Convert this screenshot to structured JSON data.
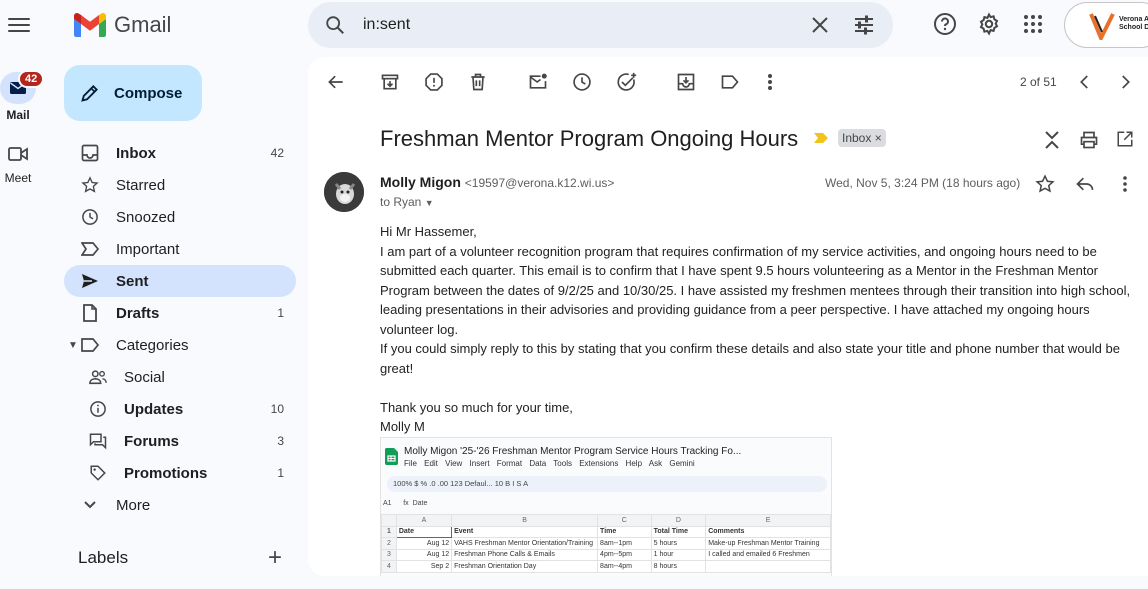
{
  "app": {
    "name": "Gmail"
  },
  "search": {
    "value": "in:sent"
  },
  "school": {
    "name": "Verona Area School District"
  },
  "rail": {
    "mail_label": "Mail",
    "mail_badge": "42",
    "meet_label": "Meet"
  },
  "compose": {
    "label": "Compose"
  },
  "nav": {
    "inbox": {
      "label": "Inbox",
      "count": "42"
    },
    "starred": {
      "label": "Starred"
    },
    "snoozed": {
      "label": "Snoozed"
    },
    "important": {
      "label": "Important"
    },
    "sent": {
      "label": "Sent"
    },
    "drafts": {
      "label": "Drafts",
      "count": "1"
    },
    "categories": {
      "label": "Categories"
    },
    "social": {
      "label": "Social"
    },
    "updates": {
      "label": "Updates",
      "count": "10"
    },
    "forums": {
      "label": "Forums",
      "count": "3"
    },
    "promotions": {
      "label": "Promotions",
      "count": "1"
    },
    "more": {
      "label": "More"
    },
    "labels": {
      "label": "Labels"
    }
  },
  "toolbar": {
    "page_count": "2 of 51"
  },
  "email": {
    "subject": "Freshman Mentor Program Ongoing Hours",
    "label_chip": "Inbox",
    "sender_name": "Molly Migon",
    "sender_email": "<19597@verona.k12.wi.us>",
    "to": "to Ryan",
    "date": "Wed, Nov 5, 3:24 PM (18 hours ago)",
    "greeting": "Hi Mr Hassemer,",
    "para1": "I am part of a volunteer recognition program that requires confirmation of my service activities, and ongoing hours need to be submitted each quarter. This email is to confirm that I have spent 9.5 hours volunteering as a Mentor in the Freshman Mentor Program between the dates of 9/2/25 and 10/30/25. I have assisted my freshmen mentees through their transition into high school, leading presentations in their advisories and providing guidance from a peer perspective. I have attached my ongoing hours volunteer log.",
    "para2": "If you could simply reply to this by stating that you confirm these details and also state your title and phone number that would be great!",
    "closing": "Thank you so much for your time,",
    "signature": "Molly M"
  },
  "attachment": {
    "title": "Molly Migon '25-'26 Freshman Mentor Program Service Hours Tracking Fo...",
    "menu": "File Edit View Insert Format Data Tools Extensions Help Ask Gemini",
    "toolbar": "100%   $   %   .0   .00   123   Defaul...   10   B   I   S   A",
    "cell_ref": "A1",
    "formula": "Date",
    "col_headers": [
      "",
      "A",
      "B",
      "C",
      "D",
      "E"
    ],
    "rows": [
      {
        "n": "1",
        "cells": [
          "Date",
          "Event",
          "Time",
          "Total Time",
          "Comments"
        ]
      },
      {
        "n": "2",
        "cells": [
          "Aug 12",
          "VAHS Freshman Mentor Orientation/Training",
          "8am--1pm",
          "5 hours",
          "Make-up Freshman Mentor Training"
        ]
      },
      {
        "n": "3",
        "cells": [
          "Aug 12",
          "Freshman Phone Calls & Emails",
          "4pm--5pm",
          "1 hour",
          "I called and emailed 6 Freshmen"
        ]
      },
      {
        "n": "4",
        "cells": [
          "Sep 2",
          "Freshman Orientation Day",
          "8am--4pm",
          "8 hours",
          ""
        ]
      }
    ]
  },
  "colors": {
    "accent": "#0b57d0",
    "compose_bg": "#c2e7ff",
    "active_nav": "#d3e3fd",
    "badge": "#b3261e"
  }
}
